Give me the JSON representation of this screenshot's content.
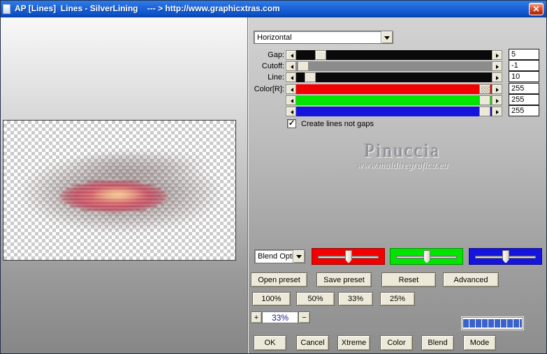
{
  "window": {
    "title": "AP [Lines]  Lines - SilverLining    --- > http://www.graphicxtras.com",
    "close_glyph": "✕"
  },
  "watermark": {
    "name": "Pinuccia",
    "site": "www.maidiregrafica.eu"
  },
  "controls": {
    "orientation_dropdown": {
      "value": "Horizontal"
    },
    "sliders": [
      {
        "label": "Gap:",
        "value": "5"
      },
      {
        "label": "Cutoff:",
        "value": "-1"
      },
      {
        "label": "Line:",
        "value": "10"
      },
      {
        "label": "Color[R]:",
        "value": "255"
      },
      {
        "label": "",
        "value": "255"
      },
      {
        "label": "",
        "value": "255"
      }
    ],
    "checkbox": {
      "label": "Create lines not gaps",
      "checked": true,
      "mark": "✓"
    },
    "blend_dropdown": {
      "value": "Blend Opti"
    },
    "buttons": {
      "open_preset": "Open preset",
      "save_preset": "Save preset",
      "reset": "Reset",
      "advanced": "Advanced",
      "zoom_100": "100%",
      "zoom_50": "50%",
      "zoom_33": "33%",
      "zoom_25": "25%",
      "ok": "OK",
      "cancel": "Cancel",
      "xtreme": "Xtreme",
      "color": "Color",
      "blend": "Blend",
      "mode": "Mode"
    },
    "zoom_stepper": {
      "plus": "+",
      "value": "33%",
      "minus": "−"
    }
  },
  "colors": {
    "titlebar_blue": "#1d63d9",
    "close_red": "#c33114",
    "track_black": "#0a0a0a",
    "track_gray": "#8c8c8c",
    "slider_red": "#f20000",
    "slider_green": "#00e400",
    "slider_blue": "#1414dc",
    "progress_blue": "#3a62c8",
    "button_face": "#ece9d8"
  }
}
